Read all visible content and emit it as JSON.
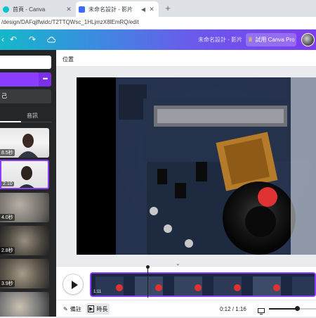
{
  "browser": {
    "tabs": [
      {
        "title": "首頁 - Canva",
        "close": "✕",
        "favicon_color": "#00c4cc"
      },
      {
        "title": "未命名設計 - 影片",
        "close": "✕",
        "favicon_color": "#3d6bff"
      }
    ],
    "new_tab": "+",
    "url": "/design/DAFqjlfwidc/T2TTQWsc_1HLjmzX8lEmRQ/edit"
  },
  "header": {
    "doc_title": "未命名設計 - 影片",
    "try_pro": "試用 Canva Pro",
    "accent": "#8b3dff"
  },
  "left_panel": {
    "record_label": "己",
    "media_tab": "音訊",
    "more": "•••",
    "thumbnails": [
      {
        "duration": "8.5秒"
      },
      {
        "duration": "2:10"
      },
      {
        "duration": "4.0秒"
      },
      {
        "duration": "2.8秒"
      },
      {
        "duration": "3.9秒"
      },
      {
        "duration": ""
      }
    ]
  },
  "toolbar": {
    "position_label": "位置"
  },
  "timeline": {
    "clip_time": "1:11"
  },
  "footer": {
    "notes_label": "備註",
    "duration_label": "時長",
    "time_readout": "0:12 / 1:16"
  }
}
